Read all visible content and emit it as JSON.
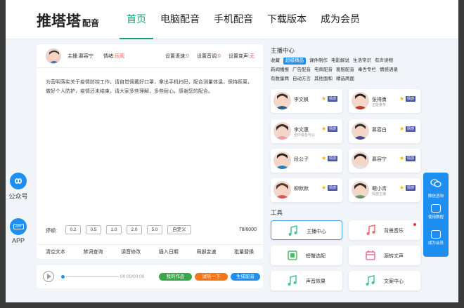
{
  "header": {
    "logo_main": "推塔塔",
    "logo_sub": "配音",
    "nav": [
      "首页",
      "电脑配音",
      "手机配音",
      "下载版本",
      "成为会员"
    ]
  },
  "left_float": {
    "wechat_label": "公众号",
    "app_badge": "APP",
    "app_label": "APP"
  },
  "editor": {
    "anchor_label": "主播:慕容宁",
    "emotion_label": "情绪:",
    "emotion_value": "乐观",
    "speed_label": "设置语速:",
    "speed_value": "0",
    "volume_label": "设置音调:",
    "volume_value": "0",
    "bgm_label": "设置变声:",
    "bgm_value": "无",
    "text": "为营明落实关于疫情防控工作，请自觉佩戴好口罩，拿出手机扫码，配合测量体温，保持距离，做好个人防护，疫情还未结束，请大家多些理解，多些耐心，感谢您的配合。",
    "pause_label": "停顿:",
    "pause_options": [
      "0.2",
      "0.5",
      "1.0",
      "2.0",
      "5.0",
      "自定义"
    ],
    "count": "78/6000",
    "tools": [
      "清空文本",
      "禁词查询",
      "读音修改",
      "插入日期",
      "局部变速",
      "批量替换"
    ]
  },
  "player": {
    "time": "00:00/00:00",
    "btn_works": "我的作品",
    "btn_try": "试听一下",
    "btn_generate": "生成配音"
  },
  "anchor_center": {
    "title": "主播中心",
    "tag_rows": [
      [
        "收藏",
        "超级精品",
        "课件制作",
        "电影解说",
        "生活常识",
        "有声读物"
      ],
      [
        "新闻播报",
        "广告配音",
        "电商配音",
        "客服配音",
        "毒舌专栏",
        "情感语录"
      ],
      [
        "有数量两",
        "自动方言",
        "其他面和",
        "精选两面"
      ]
    ],
    "anchors": [
      {
        "name": "李文枫",
        "sub": "",
        "badge": "情感"
      },
      {
        "name": "张得勇",
        "sub": "正能量专",
        "badge": "情感"
      },
      {
        "name": "李文惠",
        "sub": "全IP语音可以",
        "badge": "情感"
      },
      {
        "name": "慕容白",
        "sub": "",
        "badge": "情感"
      },
      {
        "name": "段公子",
        "sub": "",
        "badge": "情感"
      },
      {
        "name": "慕容宁",
        "sub": "",
        "badge": "情感"
      },
      {
        "name": "柳默默",
        "sub": "",
        "badge": "情感"
      },
      {
        "name": "萌小青",
        "sub": "情感主播",
        "badge": "情感"
      }
    ]
  },
  "tools": {
    "title": "工具",
    "items": [
      "主播中心",
      "背景音乐",
      "螃蟹选配",
      "源转文声",
      "声音效果",
      "文案中心"
    ]
  },
  "right_float": {
    "items": [
      "微信咨询",
      "使用教程",
      "成为会员"
    ]
  },
  "colors": {
    "brand_green": "#18a06a",
    "accent_blue": "#1e8ff0",
    "badge_purple": "#4b55a8",
    "btn_green": "#3aa64a",
    "btn_orange": "#f5761a"
  }
}
